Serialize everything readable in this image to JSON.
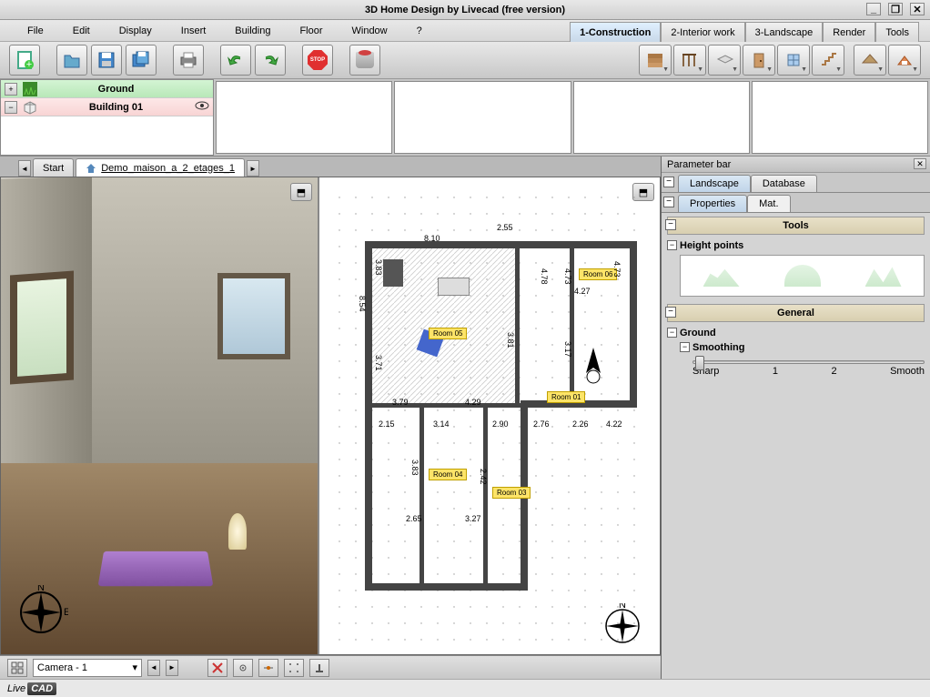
{
  "title": "3D Home Design by Livecad (free version)",
  "menu": [
    "File",
    "Edit",
    "Display",
    "Insert",
    "Building",
    "Floor",
    "Window",
    "?"
  ],
  "upper_tabs": [
    {
      "label": "1-Construction",
      "active": true
    },
    {
      "label": "2-Interior work",
      "active": false
    },
    {
      "label": "3-Landscape",
      "active": false
    },
    {
      "label": "Render",
      "active": false
    },
    {
      "label": "Tools",
      "active": false
    }
  ],
  "layers": {
    "ground": "Ground",
    "building": "Building 01"
  },
  "doc_tabs": {
    "start": "Start",
    "demo": "Demo_maison_a_2_etages_1"
  },
  "param_bar": {
    "title": "Parameter bar",
    "tabs1": {
      "landscape": "Landscape",
      "database": "Database"
    },
    "tabs2": {
      "properties": "Properties",
      "mat": "Mat."
    },
    "sections": {
      "tools": "Tools",
      "general": "General"
    },
    "height_points": "Height points",
    "ground": "Ground",
    "smoothing": "Smoothing",
    "slider": {
      "sharp": "Sharp",
      "v1": "1",
      "v2": "2",
      "smooth": "Smooth"
    }
  },
  "floorplan": {
    "rooms": {
      "r01": "Room 01",
      "r03": "Room 03",
      "r04": "Room 04",
      "r05": "Room 05",
      "r06": "Room 06"
    },
    "dims": {
      "d810": "8.10",
      "d255": "2.55",
      "d478": "4.78",
      "d473": "4.73",
      "d427": "4.27",
      "d854": "8.54",
      "d383a": "3.83",
      "d371": "3.71",
      "d381": "3.81",
      "d317": "3.17",
      "d379": "3.79",
      "d429": "4.29",
      "d215": "2.15",
      "d314": "3.14",
      "d290": "2.90",
      "d276": "2.76",
      "d226": "2.26",
      "d422": "4.22",
      "d265": "2.65",
      "d327": "3.27",
      "d383b": "3.83",
      "d242": "2.42"
    }
  },
  "status": {
    "camera": "Camera - 1"
  },
  "footer": {
    "brand1": "Live",
    "brand2": "CAD"
  }
}
